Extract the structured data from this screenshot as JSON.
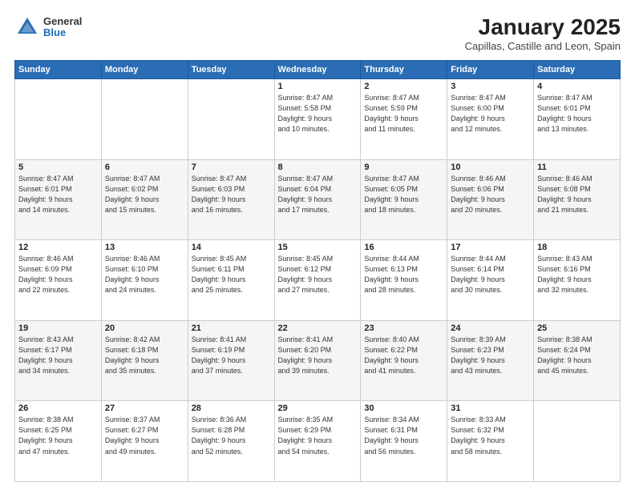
{
  "header": {
    "logo": {
      "general": "General",
      "blue": "Blue"
    },
    "title": "January 2025",
    "location": "Capillas, Castille and Leon, Spain"
  },
  "days_of_week": [
    "Sunday",
    "Monday",
    "Tuesday",
    "Wednesday",
    "Thursday",
    "Friday",
    "Saturday"
  ],
  "weeks": [
    [
      {
        "day": "",
        "info": ""
      },
      {
        "day": "",
        "info": ""
      },
      {
        "day": "",
        "info": ""
      },
      {
        "day": "1",
        "info": "Sunrise: 8:47 AM\nSunset: 5:58 PM\nDaylight: 9 hours\nand 10 minutes."
      },
      {
        "day": "2",
        "info": "Sunrise: 8:47 AM\nSunset: 5:59 PM\nDaylight: 9 hours\nand 11 minutes."
      },
      {
        "day": "3",
        "info": "Sunrise: 8:47 AM\nSunset: 6:00 PM\nDaylight: 9 hours\nand 12 minutes."
      },
      {
        "day": "4",
        "info": "Sunrise: 8:47 AM\nSunset: 6:01 PM\nDaylight: 9 hours\nand 13 minutes."
      }
    ],
    [
      {
        "day": "5",
        "info": "Sunrise: 8:47 AM\nSunset: 6:01 PM\nDaylight: 9 hours\nand 14 minutes."
      },
      {
        "day": "6",
        "info": "Sunrise: 8:47 AM\nSunset: 6:02 PM\nDaylight: 9 hours\nand 15 minutes."
      },
      {
        "day": "7",
        "info": "Sunrise: 8:47 AM\nSunset: 6:03 PM\nDaylight: 9 hours\nand 16 minutes."
      },
      {
        "day": "8",
        "info": "Sunrise: 8:47 AM\nSunset: 6:04 PM\nDaylight: 9 hours\nand 17 minutes."
      },
      {
        "day": "9",
        "info": "Sunrise: 8:47 AM\nSunset: 6:05 PM\nDaylight: 9 hours\nand 18 minutes."
      },
      {
        "day": "10",
        "info": "Sunrise: 8:46 AM\nSunset: 6:06 PM\nDaylight: 9 hours\nand 20 minutes."
      },
      {
        "day": "11",
        "info": "Sunrise: 8:46 AM\nSunset: 6:08 PM\nDaylight: 9 hours\nand 21 minutes."
      }
    ],
    [
      {
        "day": "12",
        "info": "Sunrise: 8:46 AM\nSunset: 6:09 PM\nDaylight: 9 hours\nand 22 minutes."
      },
      {
        "day": "13",
        "info": "Sunrise: 8:46 AM\nSunset: 6:10 PM\nDaylight: 9 hours\nand 24 minutes."
      },
      {
        "day": "14",
        "info": "Sunrise: 8:45 AM\nSunset: 6:11 PM\nDaylight: 9 hours\nand 25 minutes."
      },
      {
        "day": "15",
        "info": "Sunrise: 8:45 AM\nSunset: 6:12 PM\nDaylight: 9 hours\nand 27 minutes."
      },
      {
        "day": "16",
        "info": "Sunrise: 8:44 AM\nSunset: 6:13 PM\nDaylight: 9 hours\nand 28 minutes."
      },
      {
        "day": "17",
        "info": "Sunrise: 8:44 AM\nSunset: 6:14 PM\nDaylight: 9 hours\nand 30 minutes."
      },
      {
        "day": "18",
        "info": "Sunrise: 8:43 AM\nSunset: 6:16 PM\nDaylight: 9 hours\nand 32 minutes."
      }
    ],
    [
      {
        "day": "19",
        "info": "Sunrise: 8:43 AM\nSunset: 6:17 PM\nDaylight: 9 hours\nand 34 minutes."
      },
      {
        "day": "20",
        "info": "Sunrise: 8:42 AM\nSunset: 6:18 PM\nDaylight: 9 hours\nand 35 minutes."
      },
      {
        "day": "21",
        "info": "Sunrise: 8:41 AM\nSunset: 6:19 PM\nDaylight: 9 hours\nand 37 minutes."
      },
      {
        "day": "22",
        "info": "Sunrise: 8:41 AM\nSunset: 6:20 PM\nDaylight: 9 hours\nand 39 minutes."
      },
      {
        "day": "23",
        "info": "Sunrise: 8:40 AM\nSunset: 6:22 PM\nDaylight: 9 hours\nand 41 minutes."
      },
      {
        "day": "24",
        "info": "Sunrise: 8:39 AM\nSunset: 6:23 PM\nDaylight: 9 hours\nand 43 minutes."
      },
      {
        "day": "25",
        "info": "Sunrise: 8:38 AM\nSunset: 6:24 PM\nDaylight: 9 hours\nand 45 minutes."
      }
    ],
    [
      {
        "day": "26",
        "info": "Sunrise: 8:38 AM\nSunset: 6:25 PM\nDaylight: 9 hours\nand 47 minutes."
      },
      {
        "day": "27",
        "info": "Sunrise: 8:37 AM\nSunset: 6:27 PM\nDaylight: 9 hours\nand 49 minutes."
      },
      {
        "day": "28",
        "info": "Sunrise: 8:36 AM\nSunset: 6:28 PM\nDaylight: 9 hours\nand 52 minutes."
      },
      {
        "day": "29",
        "info": "Sunrise: 8:35 AM\nSunset: 6:29 PM\nDaylight: 9 hours\nand 54 minutes."
      },
      {
        "day": "30",
        "info": "Sunrise: 8:34 AM\nSunset: 6:31 PM\nDaylight: 9 hours\nand 56 minutes."
      },
      {
        "day": "31",
        "info": "Sunrise: 8:33 AM\nSunset: 6:32 PM\nDaylight: 9 hours\nand 58 minutes."
      },
      {
        "day": "",
        "info": ""
      }
    ]
  ]
}
